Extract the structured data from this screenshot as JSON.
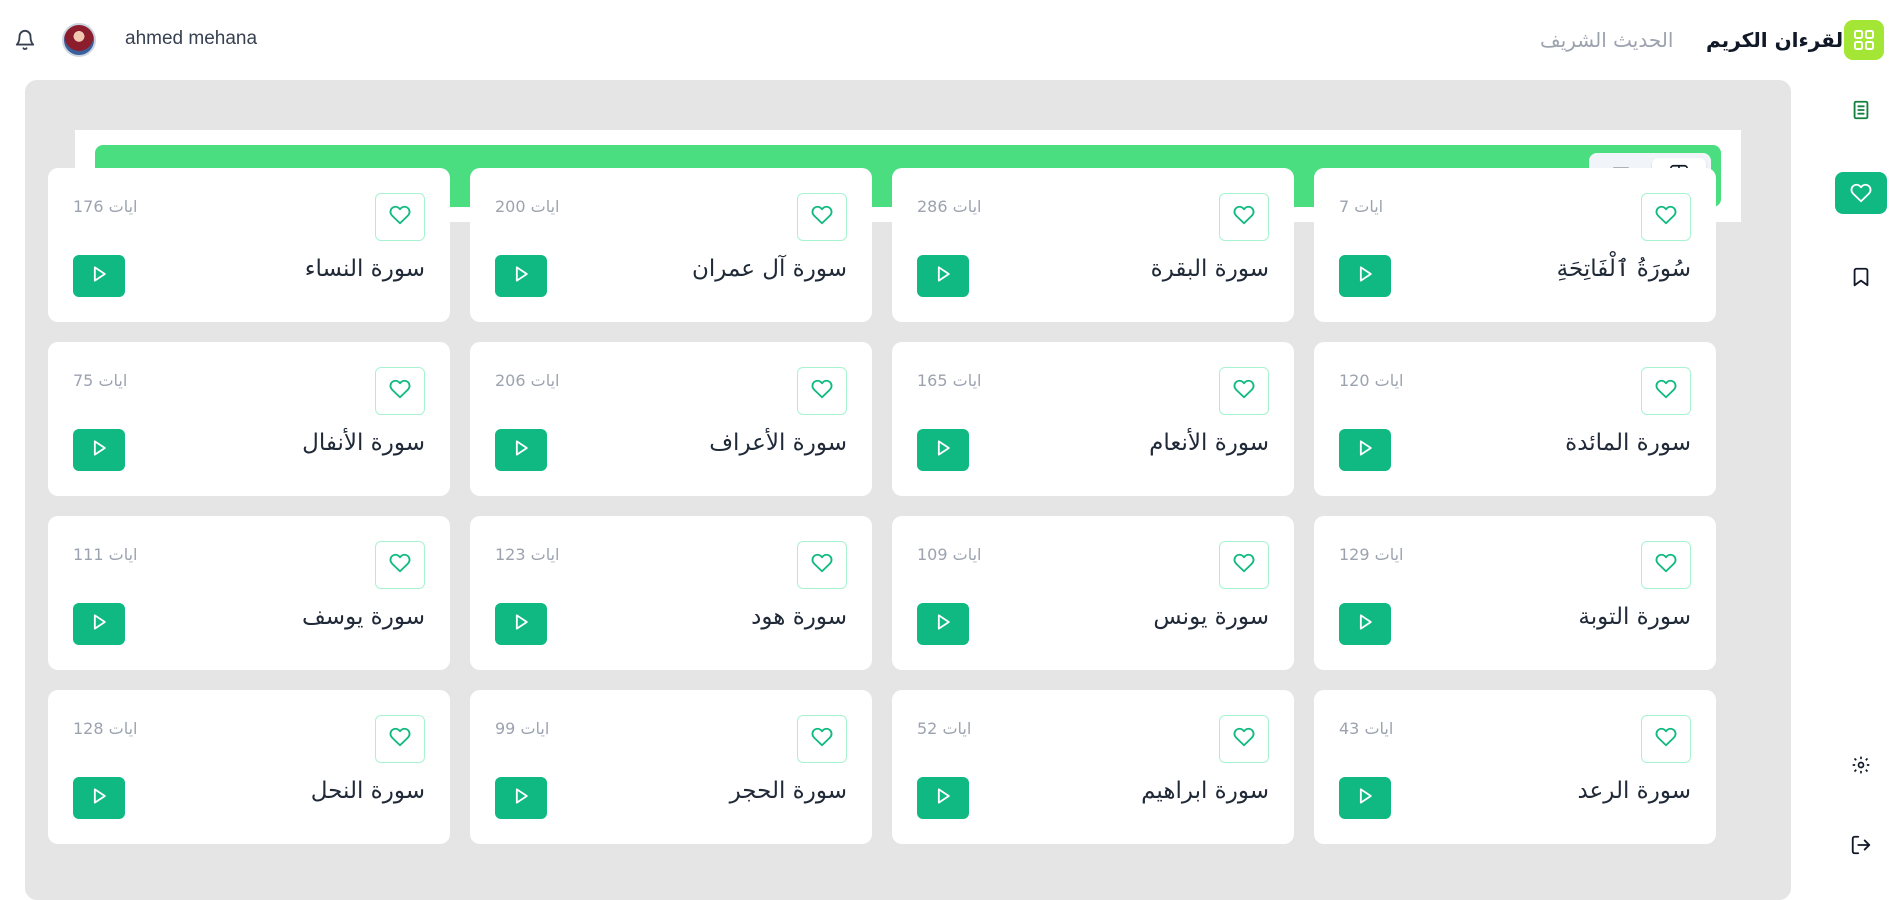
{
  "header": {
    "username": "ahmed mehana",
    "nav": {
      "quran": "القرءان الكريم",
      "hadith": "الحديث الشريف"
    }
  },
  "toolbar": {
    "view_mode": "grid"
  },
  "colors": {
    "accent": "#10b981",
    "toolbar": "#4ade80",
    "logo": "#a3e635"
  },
  "surahs": [
    {
      "name": "سُورَةُ ٱلْفَاتِحَةِ",
      "ayat": "ايات 7"
    },
    {
      "name": "سورة البقرة",
      "ayat": "ايات 286"
    },
    {
      "name": "سورة آل عمران",
      "ayat": "ايات 200"
    },
    {
      "name": "سورة النساء",
      "ayat": "ايات 176"
    },
    {
      "name": "سورة المائدة",
      "ayat": "ايات 120"
    },
    {
      "name": "سورة الأنعام",
      "ayat": "ايات 165"
    },
    {
      "name": "سورة الأعراف",
      "ayat": "ايات 206"
    },
    {
      "name": "سورة الأنفال",
      "ayat": "ايات 75"
    },
    {
      "name": "سورة التوبة",
      "ayat": "ايات 129"
    },
    {
      "name": "سورة يونس",
      "ayat": "ايات 109"
    },
    {
      "name": "سورة هود",
      "ayat": "ايات 123"
    },
    {
      "name": "سورة يوسف",
      "ayat": "ايات 111"
    },
    {
      "name": "سورة الرعد",
      "ayat": "ايات 43"
    },
    {
      "name": "سورة ابراهيم",
      "ayat": "ايات 52"
    },
    {
      "name": "سورة الحجر",
      "ayat": "ايات 99"
    },
    {
      "name": "سورة النحل",
      "ayat": "ايات 128"
    }
  ]
}
